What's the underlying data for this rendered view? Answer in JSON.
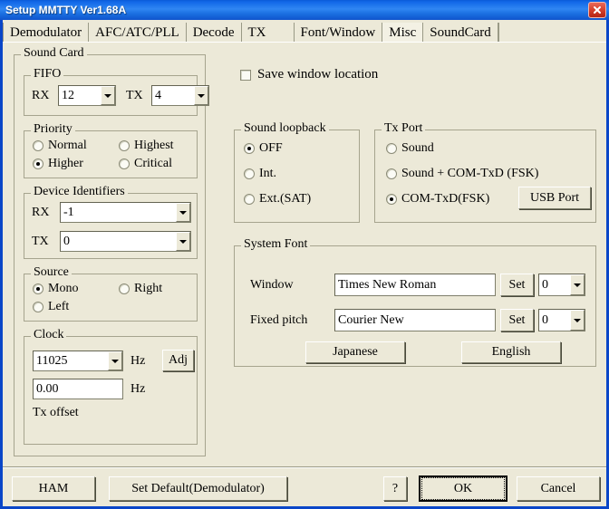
{
  "window": {
    "title": "Setup MMTTY Ver1.68A",
    "close_icon": "close-icon",
    "accent_color": "#0a5bd8",
    "face_color": "#ece9d8"
  },
  "tabs": [
    {
      "label": "Demodulator",
      "selected": false
    },
    {
      "label": "AFC/ATC/PLL",
      "selected": false
    },
    {
      "label": "Decode",
      "selected": false
    },
    {
      "label": "TX",
      "selected": false
    },
    {
      "label": "Font/Window",
      "selected": false
    },
    {
      "label": "Misc",
      "selected": true
    },
    {
      "label": "SoundCard",
      "selected": false
    }
  ],
  "sound_card": {
    "title": "Sound Card",
    "fifo": {
      "title": "FIFO",
      "rx_label": "RX",
      "rx_value": "12",
      "tx_label": "TX",
      "tx_value": "4"
    },
    "priority": {
      "title": "Priority",
      "options": [
        {
          "label": "Normal",
          "checked": false
        },
        {
          "label": "Highest",
          "checked": false
        },
        {
          "label": "Higher",
          "checked": true
        },
        {
          "label": "Critical",
          "checked": false
        }
      ]
    },
    "device_identifiers": {
      "title": "Device Identifiers",
      "rx_label": "RX",
      "rx_value": "-1",
      "tx_label": "TX",
      "tx_value": "0"
    },
    "source": {
      "title": "Source",
      "options": [
        {
          "label": "Mono",
          "checked": true
        },
        {
          "label": "Right",
          "checked": false
        },
        {
          "label": "Left",
          "checked": false
        }
      ]
    },
    "clock": {
      "title": "Clock",
      "clock_value": "11025",
      "clock_unit": "Hz",
      "adj_label": "Adj",
      "tx_offset_value": "0.00",
      "tx_offset_unit": "Hz",
      "tx_offset_label": "Tx offset"
    }
  },
  "misc": {
    "save_window_location": {
      "label": "Save window location",
      "checked": false
    },
    "sound_loopback": {
      "title": "Sound loopback",
      "options": [
        {
          "label": "OFF",
          "checked": true
        },
        {
          "label": "Int.",
          "checked": false
        },
        {
          "label": "Ext.(SAT)",
          "checked": false
        }
      ]
    },
    "tx_port": {
      "title": "Tx Port",
      "options": [
        {
          "label": "Sound",
          "checked": false
        },
        {
          "label": "Sound + COM-TxD (FSK)",
          "checked": false
        },
        {
          "label": "COM-TxD(FSK)",
          "checked": true
        }
      ],
      "usb_port_label": "USB Port"
    },
    "system_font": {
      "title": "System Font",
      "window_label": "Window",
      "window_font": "Times New Roman",
      "window_set_label": "Set",
      "window_size": "0",
      "fixed_label": "Fixed pitch",
      "fixed_font": "Courier New",
      "fixed_set_label": "Set",
      "fixed_size": "0",
      "japanese_label": "Japanese",
      "english_label": "English"
    }
  },
  "footer": {
    "ham_label": "HAM",
    "set_default_label": "Set Default(Demodulator)",
    "help_label": "?",
    "ok_label": "OK",
    "cancel_label": "Cancel"
  }
}
